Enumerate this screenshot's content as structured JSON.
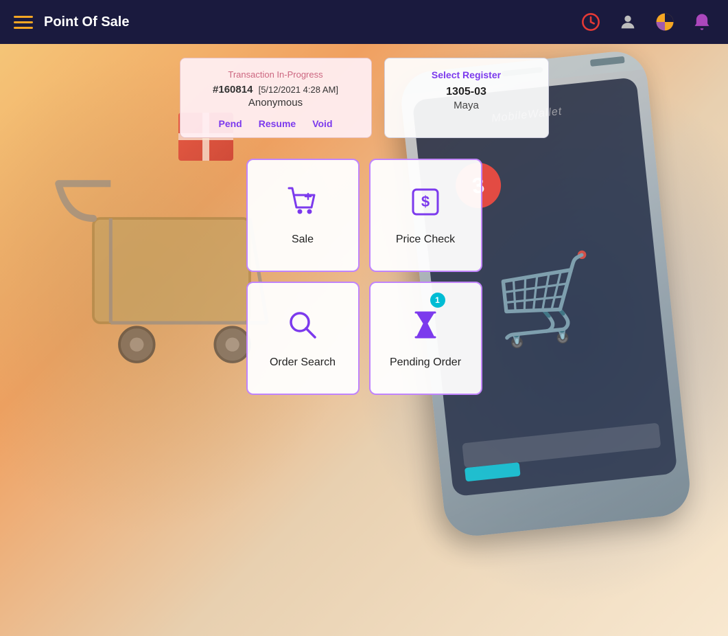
{
  "app": {
    "title": "Point Of Sale"
  },
  "topbar": {
    "menu_icon_label": "menu",
    "icons": [
      {
        "name": "clock-icon",
        "symbol": "⏱",
        "color": "#e53935"
      },
      {
        "name": "user-icon",
        "symbol": "👤",
        "color": "#bdbdbd"
      },
      {
        "name": "chart-icon",
        "symbol": "◑",
        "color": "#f5a623"
      },
      {
        "name": "bell-icon",
        "symbol": "🔔",
        "color": "#ab47bc"
      }
    ]
  },
  "transaction_card": {
    "label": "Transaction In-Progress",
    "id": "#160814",
    "date": "[5/12/2021 4:28 AM]",
    "name": "Anonymous",
    "actions": {
      "pend": "Pend",
      "resume": "Resume",
      "void": "Void"
    }
  },
  "register_card": {
    "label": "Select Register",
    "id": "1305-03",
    "name": "Maya"
  },
  "action_buttons": [
    {
      "id": "sale",
      "label": "Sale",
      "icon": "cart-plus",
      "badge": null
    },
    {
      "id": "price-check",
      "label": "Price Check",
      "icon": "dollar-square",
      "badge": null
    },
    {
      "id": "order-search",
      "label": "Order Search",
      "icon": "search",
      "badge": null
    },
    {
      "id": "pending-order",
      "label": "Pending Order",
      "icon": "hourglass",
      "badge": "1"
    }
  ]
}
